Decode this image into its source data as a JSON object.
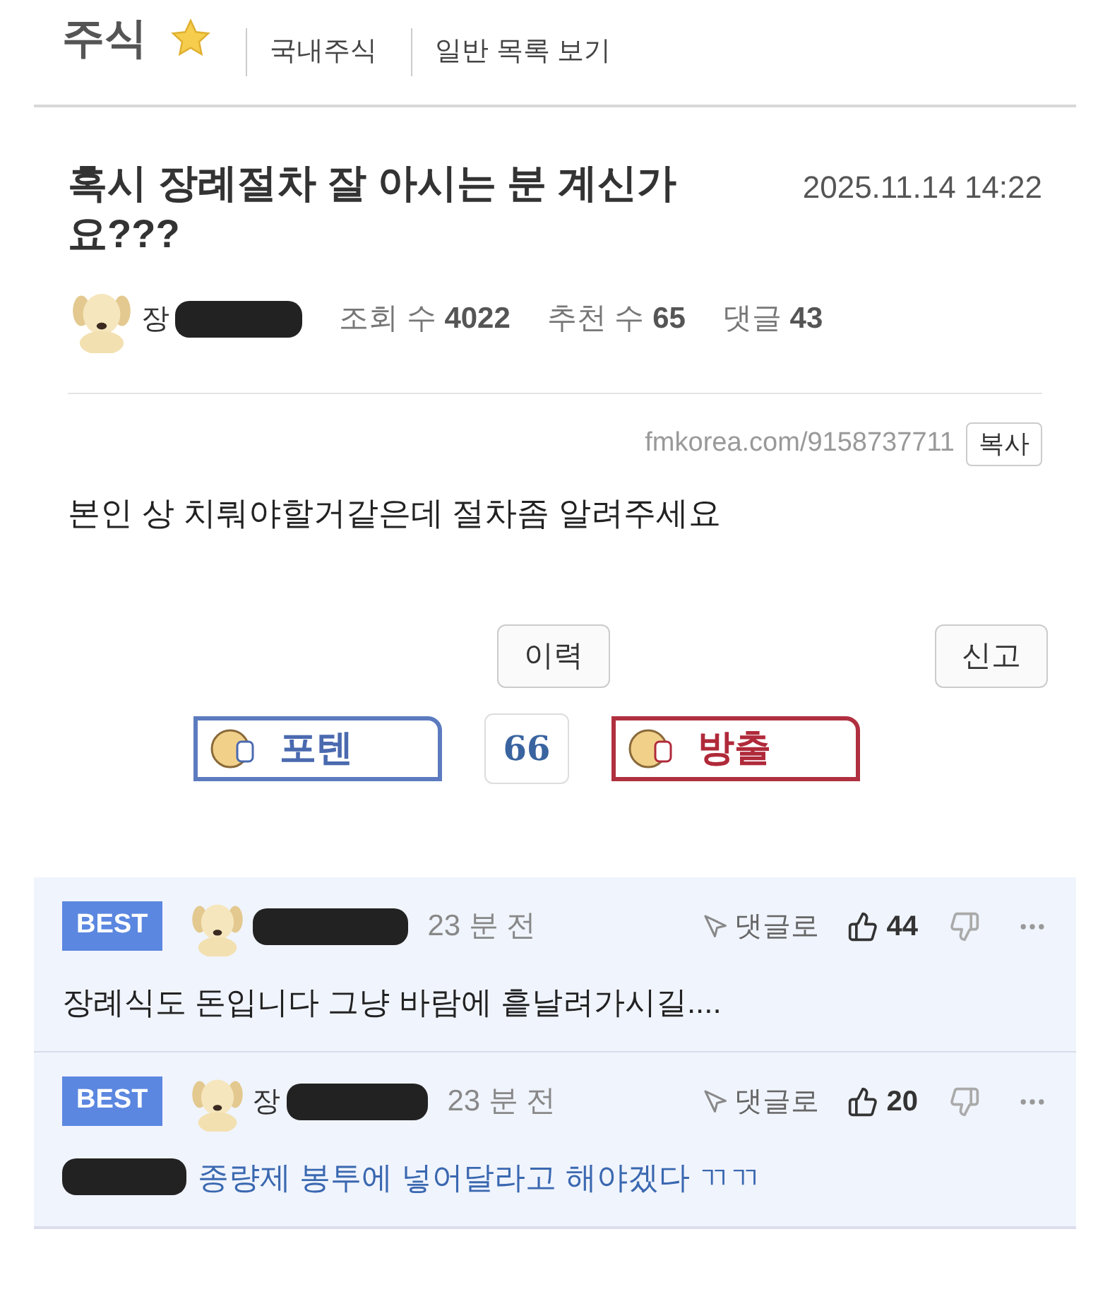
{
  "header": {
    "title": "주식",
    "favorite": true,
    "links": [
      "국내주식",
      "일반 목록 보기"
    ]
  },
  "post": {
    "title": "혹시 장례절차 잘 아시는 분 계신가요???",
    "date": "2025.11.14 14:22",
    "author_visible": "장",
    "stats": [
      {
        "label": "조회 수",
        "value": "4022"
      },
      {
        "label": "추천 수",
        "value": "65"
      },
      {
        "label": "댓글",
        "value": "43"
      }
    ],
    "url": "fmkorea.com/9158737711",
    "copy_button": "복사",
    "body": "본인 상 치뤄야할거같은데 절차좀 알려주세요",
    "history_button": "이력",
    "report_button": "신고",
    "vote": {
      "up": "포텐",
      "count": "66",
      "down": "방출"
    }
  },
  "comments": [
    {
      "badge": "BEST",
      "time": "23 분 전",
      "reply": "댓글로",
      "likes": "44",
      "text": "장례식도 돈입니다 그냥 바람에 흩날려가시길....",
      "mention": false
    },
    {
      "badge": "BEST",
      "author_visible": "장",
      "time": "23 분 전",
      "reply": "댓글로",
      "likes": "20",
      "text": "종량제 봉투에 넣어달라고 해야겠다 ㄲㄲ",
      "mention": true
    }
  ]
}
